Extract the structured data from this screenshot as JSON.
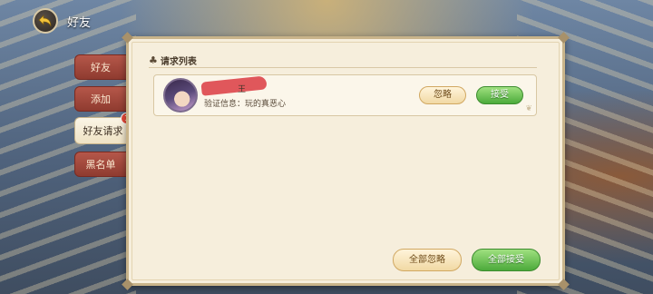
{
  "header": {
    "title": "好友"
  },
  "tabs": [
    {
      "label": "好友"
    },
    {
      "label": "添加"
    },
    {
      "label": "好友请求",
      "badge": "1"
    },
    {
      "label": "黑名单"
    }
  ],
  "panel": {
    "section_title": "请求列表",
    "requests": [
      {
        "name": "王",
        "verify_text": "验证信息：玩的真恶心",
        "ignore_label": "忽略",
        "accept_label": "接受"
      }
    ],
    "ignore_all_label": "全部忽略",
    "accept_all_label": "全部接受"
  },
  "colors": {
    "accept_green": "#4caa3b",
    "ignore_gold": "#f1d9a4",
    "tab_red": "#8f3b30",
    "panel_bg": "#f6eedc"
  },
  "icons": {
    "back": "back-arrow-icon",
    "section": "club-icon"
  }
}
